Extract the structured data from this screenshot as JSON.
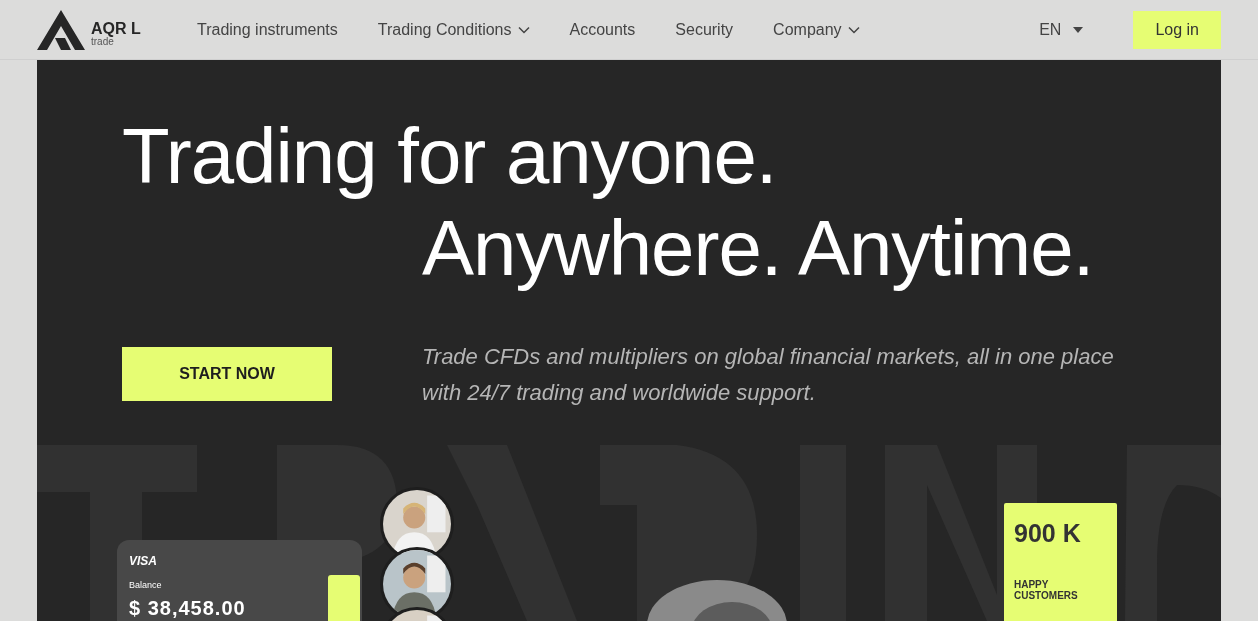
{
  "header": {
    "logo": {
      "name": "AQR L",
      "sub": "trade"
    },
    "nav": [
      {
        "label": "Trading instruments",
        "dropdown": false
      },
      {
        "label": "Trading Conditions",
        "dropdown": true
      },
      {
        "label": "Accounts",
        "dropdown": false
      },
      {
        "label": "Security",
        "dropdown": false
      },
      {
        "label": "Company",
        "dropdown": true
      }
    ],
    "language": "EN",
    "login": "Log in"
  },
  "hero": {
    "title_line_1": "Trading for anyone.",
    "title_line_2": "Anywhere. Anytime.",
    "cta": "START NOW",
    "subtitle": "Trade CFDs and multipliers on global financial markets, all in one place with 24/7 trading and worldwide support.",
    "card": {
      "brand": "VISA",
      "label": "Balance",
      "amount": "$ 38,458.00"
    },
    "stat": {
      "value": "900 K",
      "label": "HAPPY CUSTOMERS"
    }
  }
}
